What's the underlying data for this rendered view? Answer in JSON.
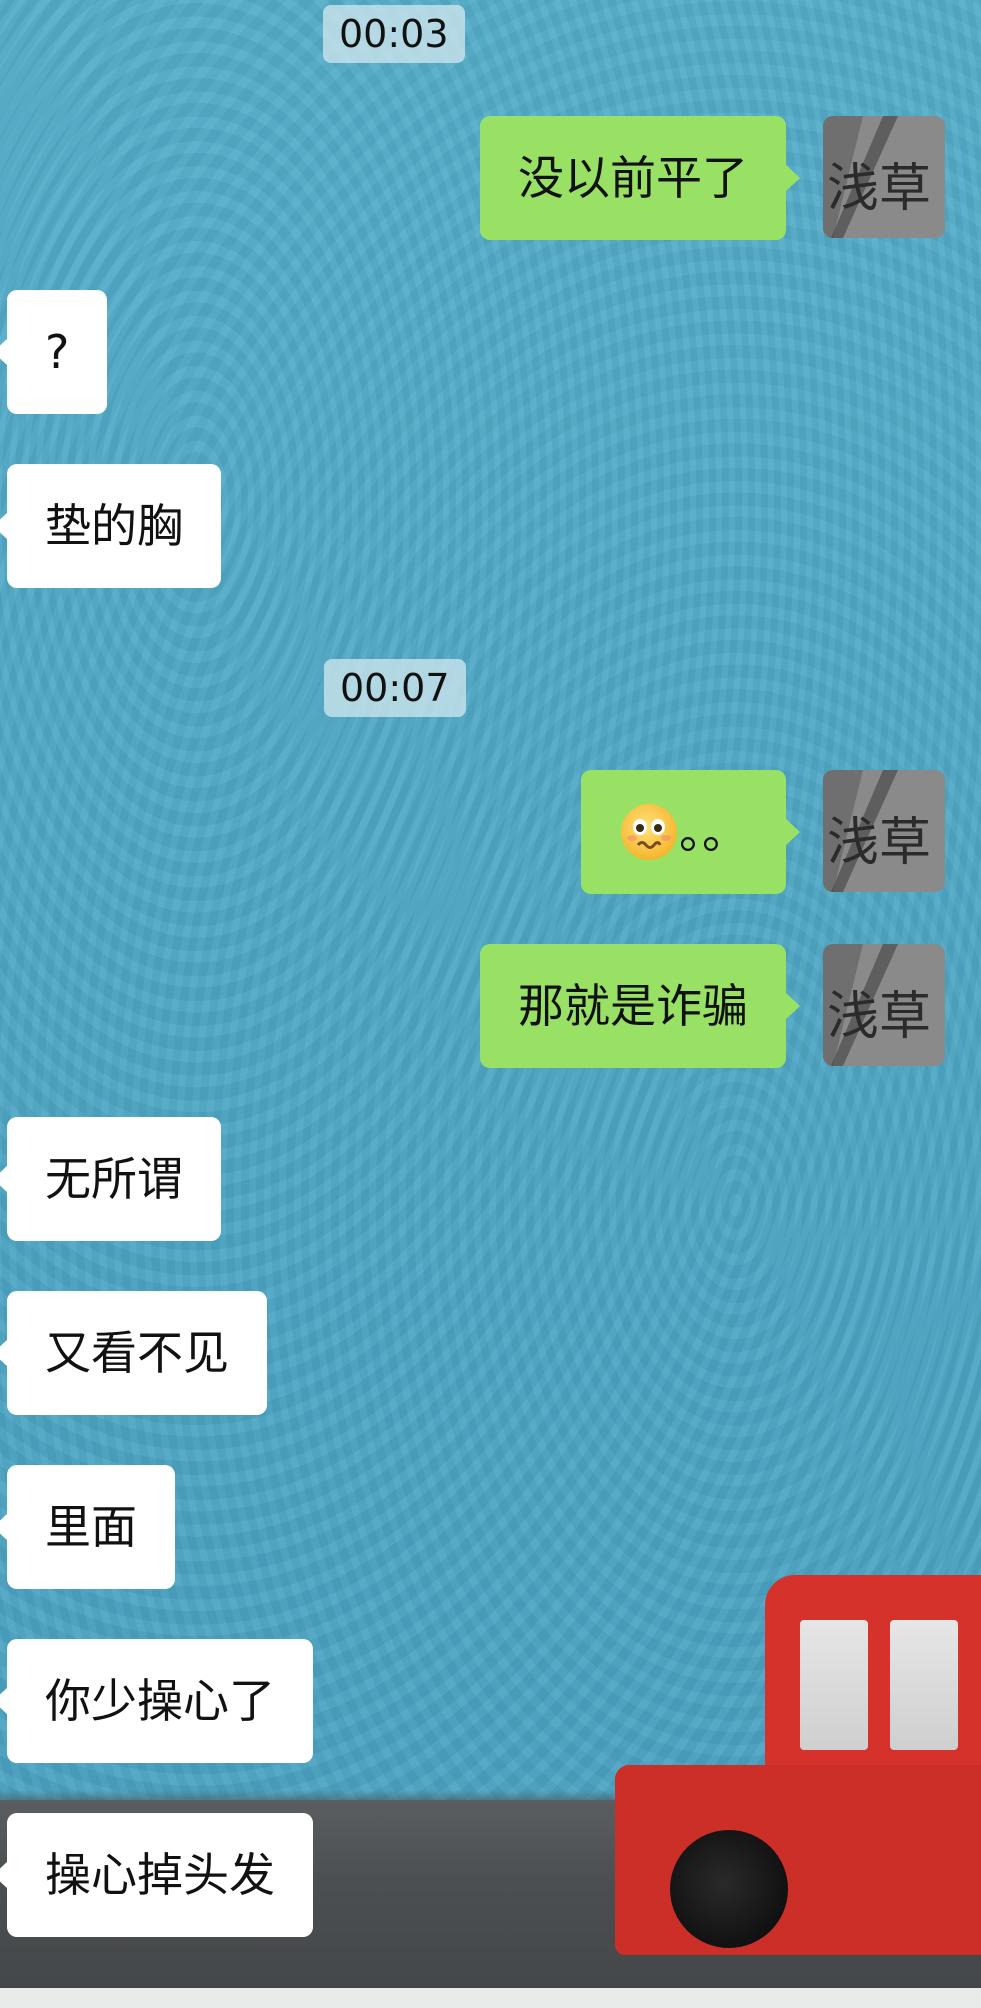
{
  "conversation": {
    "timestamps": [
      "00:03",
      "00:07"
    ],
    "messages": [
      {
        "sender": "me",
        "text": "没以前平了"
      },
      {
        "sender": "other",
        "text": "?"
      },
      {
        "sender": "other",
        "text": "垫的胸"
      },
      {
        "sender": "me",
        "emoji": "woozy-face-emoji",
        "text": "。。"
      },
      {
        "sender": "me",
        "text": "那就是诈骗"
      },
      {
        "sender": "other",
        "text": "无所谓"
      },
      {
        "sender": "other",
        "text": "又看不见"
      },
      {
        "sender": "other",
        "text": "里面"
      },
      {
        "sender": "other",
        "text": "你少操心了"
      },
      {
        "sender": "other",
        "text": "操心掉头发"
      }
    ]
  },
  "avatar": {
    "text": "浅草"
  },
  "colors": {
    "wallpaper": "#4fa8c6",
    "outgoing_bubble": "#98e165",
    "incoming_bubble": "#ffffff",
    "timestamp_background": "#cde6ec",
    "car": "#cc2f28"
  }
}
